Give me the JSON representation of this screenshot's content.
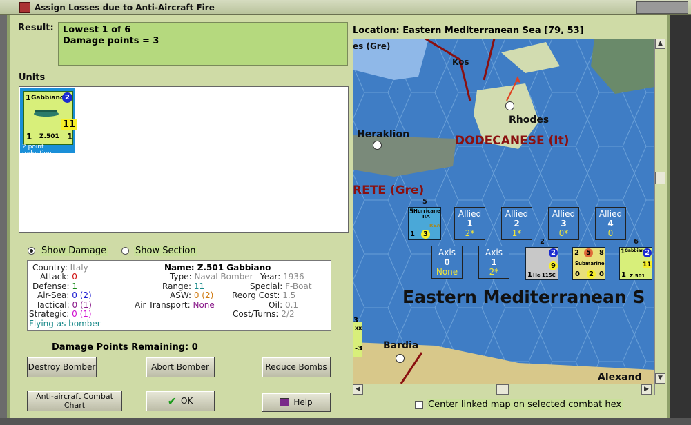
{
  "window": {
    "title": "Assign Losses due to Anti-Aircraft Fire"
  },
  "result": {
    "label": "Result:",
    "line1": "Lowest 1 of 6",
    "line2": "Damage points = 3"
  },
  "units": {
    "label": "Units",
    "card": {
      "name": "Gabbiano",
      "model": "Z.501",
      "top_left": "1",
      "circle": "2",
      "attack": "11",
      "bl": "1",
      "br": "1",
      "note": "2 point reduction."
    }
  },
  "view": {
    "show_damage": "Show Damage",
    "show_section": "Show Section"
  },
  "info": {
    "country_k": "Country:",
    "country_v": "Italy",
    "attack_k": "Attack:",
    "attack_v": "0",
    "defense_k": "Defense:",
    "defense_v": "1",
    "airsea_k": "Air-Sea:",
    "airsea_v": "0 (2)",
    "tactical_k": "Tactical:",
    "tactical_v": "0 (1)",
    "strategic_k": "Strategic:",
    "strategic_v": "0 (1)",
    "flying": "Flying as bomber",
    "name_k": "Name:",
    "name_v": "Z.501 Gabbiano",
    "type_k": "Type:",
    "type_v": "Naval Bomber",
    "year_k": "Year:",
    "year_v": "1936",
    "range_k": "Range:",
    "range_v": "11",
    "special_k": "Special:",
    "special_v": "F-Boat",
    "asw_k": "ASW:",
    "asw_v": "0 (2)",
    "reorg_k": "Reorg Cost:",
    "reorg_v": "1.5",
    "airtrans_k": "Air Transport:",
    "airtrans_v": "None",
    "oil_k": "Oil:",
    "oil_v": "0.1",
    "cost_k": "Cost/Turns:",
    "cost_v": "2/2"
  },
  "damage": {
    "label": "Damage Points Remaining:",
    "value": "0"
  },
  "buttons": {
    "destroy": "Destroy Bomber",
    "abort": "Abort Bomber",
    "reduce": "Reduce Bombs",
    "aa_chart": "Anti-aircraft Combat Chart",
    "ok": "OK",
    "help": "Help"
  },
  "location": {
    "label": "Location:",
    "value": "Eastern Mediterranean Sea [79, 53]"
  },
  "map": {
    "gre_top": "es (Gre)",
    "kos": "Kos",
    "rhodes": "Rhodes",
    "heraklion": "Heraklion",
    "dodecanese": "DODECANESE (It)",
    "crete": "RETE (Gre)",
    "sea": "Eastern Mediterranean S",
    "bardia": "Bardia",
    "alexand": "Alexand",
    "allied_boxes": [
      {
        "side": "Allied",
        "num": "1",
        "val": "2*"
      },
      {
        "side": "Allied",
        "num": "2",
        "val": "1*"
      },
      {
        "side": "Allied",
        "num": "3",
        "val": "0*"
      },
      {
        "side": "Allied",
        "num": "4",
        "val": "0"
      }
    ],
    "axis_boxes": [
      {
        "side": "Axis",
        "num": "0",
        "val": "None"
      },
      {
        "side": "Axis",
        "num": "1",
        "val": "2*"
      }
    ],
    "hurricane": {
      "name": "Hurricane",
      "variant": "IIA",
      "tag": "RSA",
      "stack": "5",
      "tl": "5",
      "bl": "1",
      "circle": "3"
    },
    "he115": {
      "name": "He 115C",
      "stack": "2",
      "circle": "2",
      "val": "9",
      "bl": "1"
    },
    "submarine": {
      "name": "Submarine",
      "tl": "2",
      "circle": "5",
      "tr": "8",
      "b1": "0",
      "b2": "2",
      "b3": "0"
    },
    "gabbiano": {
      "name": "Gabbiano",
      "model": "Z.501",
      "stack": "6",
      "tl": "1",
      "circle": "2",
      "val": "11",
      "bl": "1"
    },
    "left_unit": {
      "top": "3",
      "code": "xx",
      "val": "-3"
    }
  },
  "center_check": "Center linked map on selected combat hex"
}
